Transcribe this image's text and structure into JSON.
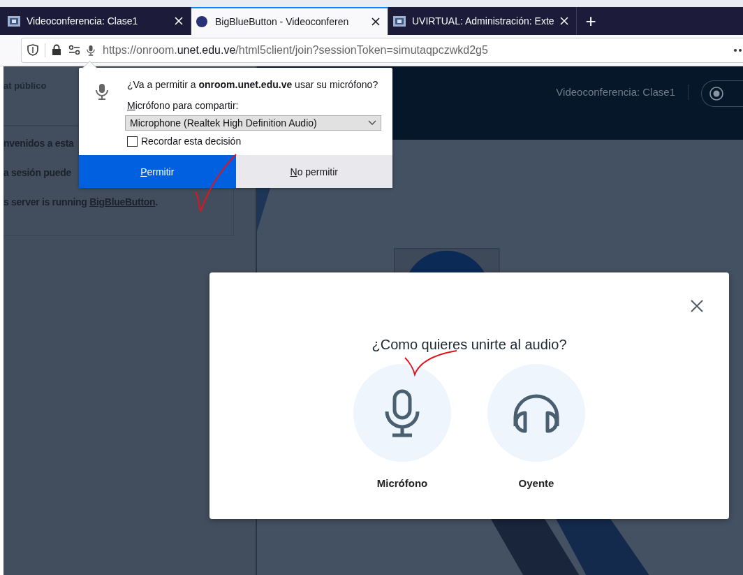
{
  "browser": {
    "tabs": [
      {
        "title": "Videoconferencia: Clase1",
        "kind": "site",
        "selected": false
      },
      {
        "title": "BigBlueButton - Videoconferen",
        "kind": "logo",
        "selected": true
      },
      {
        "title": "UVIRTUAL: Administración: Exte",
        "kind": "site",
        "selected": false
      }
    ],
    "new_tab": "+",
    "address": {
      "prefix": "https://onroom.",
      "domain": "unet.edu.ve",
      "suffix": "/html5client/join?sessionToken=simutaqpczwkd2g5"
    }
  },
  "permission_popup": {
    "question": "¿Va a permitir a **onroom.unet.edu.ve** usar su micrófono?",
    "select_label": "Micrófono para compartir:",
    "select_value": "Microphone (Realtek High Definition Audio)",
    "remember": {
      "label": "Recordar esta decisión",
      "checked": false
    },
    "buttons": [
      {
        "label": "Permitir",
        "kind": "primary"
      },
      {
        "label": "No permitir",
        "kind": "secondary"
      }
    ]
  },
  "chat": {
    "title": "at público",
    "messages": [
      {
        "text": "nvenidos a esta"
      },
      {
        "text": "a sesión puede"
      },
      {
        "text": "s server is running ",
        "link": "BigBlueButton",
        "after": "."
      }
    ]
  },
  "meeting_header": {
    "title": "Videoconferencia: Clase1"
  },
  "audio_modal": {
    "title": "¿Como quieres unirte al audio?",
    "options": [
      {
        "label": "Micrófono",
        "kind": "microphone"
      },
      {
        "label": "Oyente",
        "kind": "headphones"
      }
    ]
  }
}
